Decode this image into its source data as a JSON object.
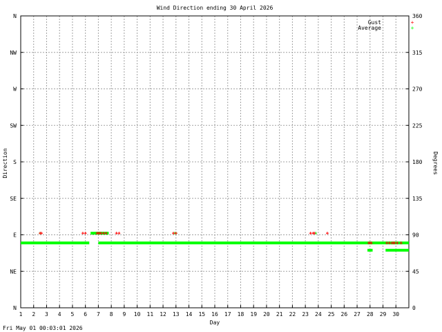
{
  "chart_data": {
    "type": "scatter",
    "title": "Wind Direction ending 30 April 2026",
    "xlabel": "Day",
    "ylabel_left": "Direction",
    "ylabel_right": "Degrees",
    "timestamp": "Fri May 01 00:03:01 2026",
    "xlim": [
      1,
      31
    ],
    "ylim": [
      0,
      360
    ],
    "grid": true,
    "legend_position": "top-right",
    "x_ticks": [
      "1",
      "2",
      "3",
      "4",
      "5",
      "6",
      "7",
      "8",
      "9",
      "10",
      "11",
      "12",
      "13",
      "14",
      "15",
      "16",
      "17",
      "18",
      "19",
      "20",
      "21",
      "22",
      "23",
      "24",
      "25",
      "26",
      "27",
      "28",
      "29",
      "30"
    ],
    "y_ticks_left": [
      {
        "value": 0,
        "label": "N"
      },
      {
        "value": 45,
        "label": "NE"
      },
      {
        "value": 90,
        "label": "E"
      },
      {
        "value": 135,
        "label": "SE"
      },
      {
        "value": 180,
        "label": "S"
      },
      {
        "value": 225,
        "label": "SW"
      },
      {
        "value": 270,
        "label": "W"
      },
      {
        "value": 315,
        "label": "NW"
      },
      {
        "value": 360,
        "label": "N"
      }
    ],
    "y_ticks_right": [
      {
        "value": 0,
        "label": "0"
      },
      {
        "value": 45,
        "label": "45"
      },
      {
        "value": 90,
        "label": "90"
      },
      {
        "value": 135,
        "label": "135"
      },
      {
        "value": 180,
        "label": "180"
      },
      {
        "value": 225,
        "label": "225"
      },
      {
        "value": 270,
        "label": "270"
      },
      {
        "value": 315,
        "label": "315"
      },
      {
        "value": 360,
        "label": "360"
      }
    ],
    "series": [
      {
        "name": "Gust",
        "color": "#ff0000",
        "marker": "+",
        "points": [
          [
            2.5,
            92
          ],
          [
            2.6,
            92
          ],
          [
            5.8,
            92
          ],
          [
            6.0,
            92
          ],
          [
            6.9,
            92
          ],
          [
            7.0,
            92
          ],
          [
            7.1,
            92
          ],
          [
            7.2,
            92
          ],
          [
            7.4,
            92
          ],
          [
            7.6,
            92
          ],
          [
            8.4,
            92
          ],
          [
            8.6,
            92
          ],
          [
            12.8,
            92
          ],
          [
            13.0,
            92
          ],
          [
            23.4,
            92
          ],
          [
            23.6,
            92
          ],
          [
            23.7,
            92
          ],
          [
            24.7,
            92
          ],
          [
            27.9,
            80
          ],
          [
            28.0,
            80
          ],
          [
            28.1,
            80
          ],
          [
            29.3,
            80
          ],
          [
            29.5,
            80
          ],
          [
            29.7,
            80
          ],
          [
            29.8,
            80
          ],
          [
            29.9,
            80
          ],
          [
            30.1,
            80
          ],
          [
            30.4,
            80
          ]
        ]
      },
      {
        "name": "Average",
        "color": "#00ff00",
        "marker": "+",
        "segments": [
          {
            "x_start": 1.0,
            "x_end": 6.3,
            "y": 80
          },
          {
            "x_start": 6.4,
            "x_end": 7.8,
            "y": 92
          },
          {
            "x_start": 7.0,
            "x_end": 31.0,
            "y": 80
          },
          {
            "x_start": 27.8,
            "x_end": 28.2,
            "y": 71
          },
          {
            "x_start": 29.2,
            "x_end": 31.0,
            "y": 71
          }
        ],
        "points": [
          [
            2.5,
            92
          ],
          [
            12.9,
            92
          ],
          [
            13.0,
            92
          ],
          [
            23.8,
            92
          ]
        ]
      }
    ]
  }
}
